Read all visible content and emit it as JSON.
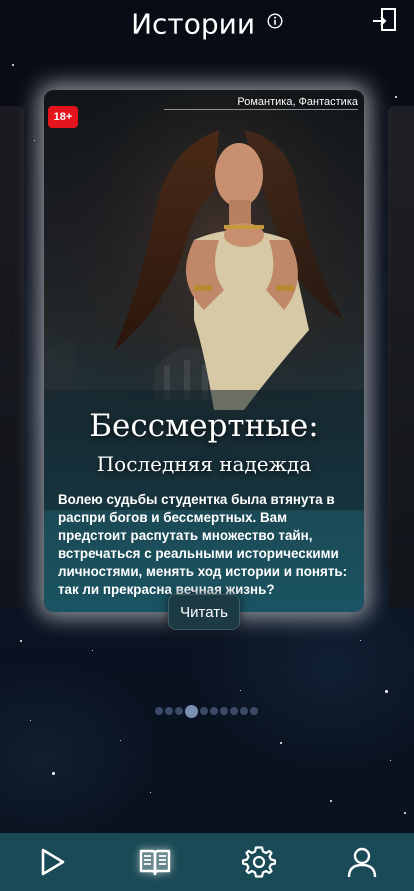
{
  "header": {
    "title": "Истории",
    "info_icon": "info-icon",
    "share_icon": "share-icon"
  },
  "story": {
    "age_rating": "18+",
    "genres": "Романтика, Фантастика",
    "title": "Бессмертные:",
    "subtitle": "Последняя надежда",
    "description": "Волею судьбы студентка была втянута в распри богов и бессмертных. Вам предстоит распутать множество тайн, встречаться с реальными историческими личностями, менять ход истории и понять: так ли прекрасна вечная жизнь?",
    "read_label": "Читать"
  },
  "pagination": {
    "total": 10,
    "active_index": 3
  },
  "bottom_nav": {
    "items": [
      {
        "icon": "play-icon",
        "active": false
      },
      {
        "icon": "book-icon",
        "active": true
      },
      {
        "icon": "gear-icon",
        "active": false
      },
      {
        "icon": "user-icon",
        "active": false
      }
    ]
  },
  "colors": {
    "background": "#0a1220",
    "nav_bar": "#1a4a55",
    "age_badge": "#e3141c",
    "button": "#1b3a43"
  }
}
